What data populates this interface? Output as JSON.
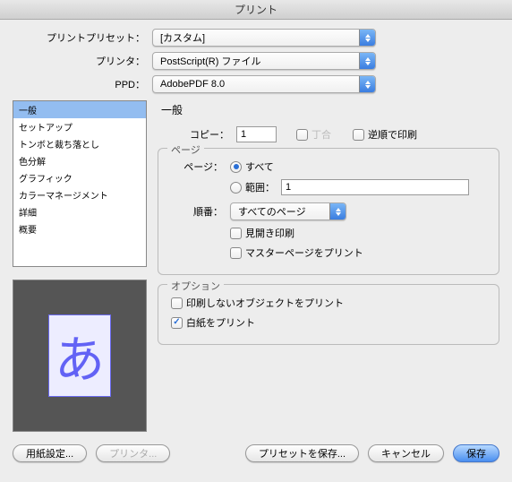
{
  "window": {
    "title": "プリント"
  },
  "top": {
    "preset_label": "プリントプリセット：",
    "preset_value": "[カスタム]",
    "printer_label": "プリンタ：",
    "printer_value": "PostScript(R) ファイル",
    "ppd_label": "PPD：",
    "ppd_value": "AdobePDF 8.0"
  },
  "sidebar": {
    "items": [
      {
        "label": "一般",
        "selected": true
      },
      {
        "label": "セットアップ"
      },
      {
        "label": "トンボと裁ち落とし"
      },
      {
        "label": "色分解"
      },
      {
        "label": "グラフィック"
      },
      {
        "label": "カラーマネージメント"
      },
      {
        "label": "詳細"
      },
      {
        "label": "概要"
      }
    ]
  },
  "preview_glyph": "あ",
  "panel": {
    "title": "一般",
    "copies_label": "コピー：",
    "copies_value": "1",
    "collate_label": "丁合",
    "reverse_label": "逆順で印刷",
    "pages": {
      "group_title": "ページ",
      "pages_label": "ページ：",
      "all_label": "すべて",
      "range_label": "範囲：",
      "range_value": "1",
      "order_label": "順番：",
      "order_value": "すべてのページ",
      "spreads_label": "見開き印刷",
      "master_label": "マスターページをプリント"
    },
    "options": {
      "group_title": "オプション",
      "nonprint_label": "印刷しないオブジェクトをプリント",
      "blank_label": "白紙をプリント"
    }
  },
  "buttons": {
    "page_setup": "用紙設定...",
    "printer": "プリンタ...",
    "save_preset": "プリセットを保存...",
    "cancel": "キャンセル",
    "save": "保存"
  }
}
